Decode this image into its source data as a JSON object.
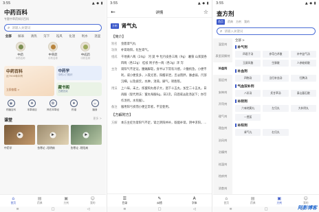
{
  "status": {
    "time": "3:55",
    "icons": "▲ ◆ ▮"
  },
  "p1": {
    "title": "中药百科",
    "subtitle": "专题中草药知识百科",
    "search_placeholder": "请输入关键词",
    "categories": [
      "全部",
      "解表",
      "清热",
      "泻下",
      "祛风",
      "化湿",
      "利水",
      "温里"
    ],
    "herbs": [
      {
        "name": "中药",
        "tag": "中药名称"
      },
      {
        "name": "中草药",
        "tag": "中药名称"
      },
      {
        "name": "中成药",
        "tag": "中药名称"
      }
    ],
    "card_main": {
      "title": "中药百科",
      "subtitle": "近7000味中药",
      "go": "立即查看 >"
    },
    "card_a": {
      "title": "中药学",
      "subtitle": "中药入门知识"
    },
    "card_b": {
      "title": "藏书阁",
      "subtitle": "古籍查阅"
    },
    "icons": [
      {
        "label": "药膳百科",
        "glyph": "◉"
      },
      {
        "label": "本草纲目",
        "glyph": "❖"
      },
      {
        "label": "神农本草经",
        "glyph": "✿"
      },
      {
        "label": "药谱",
        "glyph": "♦"
      },
      {
        "label": "膳食",
        "glyph": "☕"
      }
    ],
    "course_title": "课堂",
    "course_more": "更多 >",
    "lessons": [
      "中药学",
      "伤寒论 -阳明病",
      "伤寒论 -阴阳病"
    ],
    "tabs": [
      "首页",
      "药典",
      "方剂",
      "我的"
    ]
  },
  "p2": {
    "title": "详情",
    "badge": "方剂",
    "name": "肾气丸",
    "section1": "【简介】",
    "rows": [
      {
        "k": "别名",
        "v": "金匮肾气丸"
      },
      {
        "k": "功效",
        "v": "补肾助阳，化生肾气。"
      },
      {
        "k": "组成",
        "v": "干地黄八两（24g） 河 萸 牛 牡丹皮各三两（9g） 薯蓣 山茱萸各四两（各12g） 桂枝 附子各一两（各3g）泽 泻"
      },
      {
        "k": "主治",
        "v": "肾阳气不足证。腰痛脚软，身半以下常有冷感，少腹拘急，小便不利，或小便反多，入夜尤甚，阳痿早泄，舌淡而胖，脉虚弱，尺部沉细，以及痰饮，水肿，消渴，脚气，转胞等。"
      },
      {
        "k": "用法",
        "v": "上八味，末之，炼蜜和丸梧子大，酒下十五丸，加至二十五丸，日再服（现代用法：蜜丸每服6g，日2次，白酒或淡盐汤送下；亦可作汤剂，水煎服）。"
      },
      {
        "k": "备注",
        "v": "服用阳亏损而小便正常者，不宜使用。"
      }
    ],
    "section2": "【方解附方】",
    "fangjie": {
      "k": "方解",
      "v": "本方主症为肾阳气不足，肾之阴阳并补，既能补肾，阴中求阳，..."
    },
    "tabs": [
      "目录",
      "纠错",
      "字体"
    ]
  },
  "p3": {
    "title": "查方剂",
    "tabs": [
      "首页",
      "药典",
      "方剂",
      "我的"
    ],
    "search_placeholder": "请输入关键词",
    "side": [
      "温里剂",
      "表里双解剂",
      "补益剂",
      "固涩剂",
      "安神剂",
      "开窍剂",
      "理气剂",
      "理血剂",
      "治风剂",
      "治燥剂",
      "祛湿剂",
      "祛痰剂",
      "消食剂",
      "驱虫剂"
    ],
    "all_label": "全部 >",
    "groups": [
      {
        "name": "补气剂",
        "items": [
          "四君子汤",
          "参苓白术散",
          "补中益气汤",
          "玉屏风散",
          "生脉散",
          "人参蛤蚧散"
        ]
      },
      {
        "name": "补血剂",
        "items": [
          "四物汤",
          "当归补血汤",
          "归脾汤"
        ]
      },
      {
        "name": "气血双补剂",
        "items": [
          "八珍汤",
          "炙甘草汤",
          "泰山磐石散"
        ]
      },
      {
        "name": "补阴剂",
        "items": [
          "六味地黄丸",
          "左归丸",
          "大补阴丸",
          "一贯煎"
        ]
      },
      {
        "name": "补阳剂",
        "items": [
          "肾气丸",
          "右归丸"
        ]
      }
    ],
    "watermark": "阿影博客"
  }
}
